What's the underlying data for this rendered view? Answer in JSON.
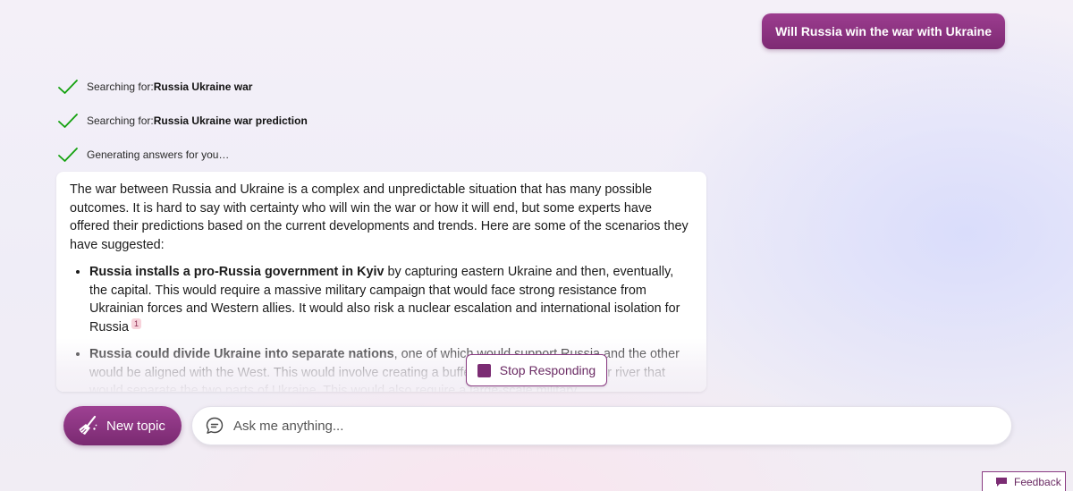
{
  "user_message": "Will Russia win the war with Ukraine",
  "progress": [
    {
      "prefix": "Searching for: ",
      "query": "Russia Ukraine war"
    },
    {
      "prefix": "Searching for: ",
      "query": "Russia Ukraine war prediction"
    },
    {
      "prefix": "Generating answers for you…",
      "query": ""
    }
  ],
  "answer": {
    "intro": "The war between Russia and Ukraine is a complex and unpredictable situation that has many possible outcomes. It is hard to say with certainty who will win the war or how it will end, but some experts have offered their predictions based on the current developments and trends. Here are some of the scenarios they have suggested:",
    "bullets": [
      {
        "bold": "Russia installs a pro-Russia government in Kyiv",
        "text": " by capturing eastern Ukraine and then, eventually, the capital. This would require a massive military campaign that would face strong resistance from Ukrainian forces and Western allies. It would also risk a nuclear escalation and international isolation for Russia",
        "citation": "1"
      },
      {
        "bold": "Russia could divide Ukraine into separate nations",
        "text": ", one of which would support Russia and the other would be aligned with the West. This would involve creating a buffer zone along the Dnieper river that would separate the two parts of Ukraine. This would also require a large-scale military",
        "citation": ""
      }
    ]
  },
  "controls": {
    "stop_label": "Stop Responding",
    "new_topic_label": "New topic",
    "ask_placeholder": "Ask me anything...",
    "feedback_label": "Feedback"
  },
  "icons": {
    "check": "check-icon",
    "stop": "stop-square-icon",
    "new_topic": "broom-icon",
    "ask": "chat-bubble-icon",
    "feedback": "feedback-icon"
  },
  "colors": {
    "accent": "#8a3b82",
    "accent_dark": "#7a2a71",
    "check_green": "#13a10e"
  }
}
